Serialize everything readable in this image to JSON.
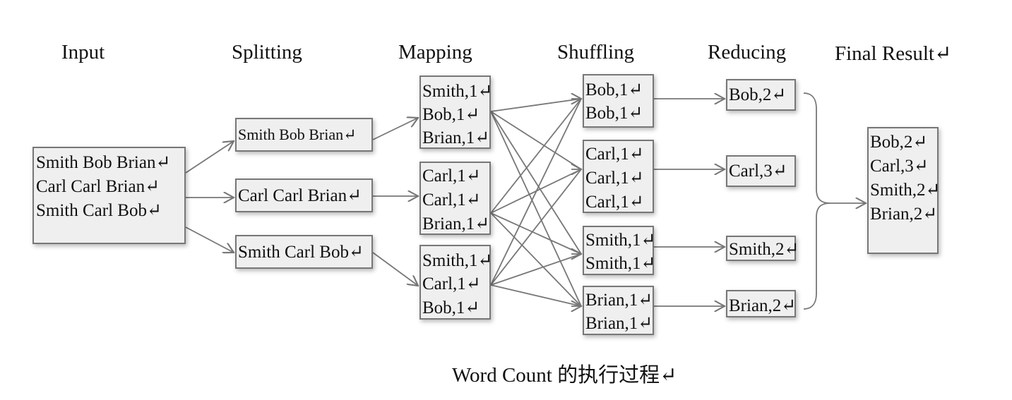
{
  "headers": {
    "input": "Input",
    "splitting": "Splitting",
    "mapping": "Mapping",
    "shuffling": "Shuffling",
    "reducing": "Reducing",
    "final": "Final Result↵"
  },
  "input": {
    "lines": [
      "Smith Bob Brian↵",
      "Carl Carl Brian↵",
      "Smith Carl Bob↵"
    ]
  },
  "splits": [
    {
      "lines": [
        "Smith Bob Brian↵"
      ]
    },
    {
      "lines": [
        "Carl Carl Brian↵"
      ]
    },
    {
      "lines": [
        "Smith Carl Bob↵"
      ]
    }
  ],
  "maps": [
    {
      "lines": [
        "Smith,1↵",
        "Bob,1↵",
        "Brian,1↵"
      ]
    },
    {
      "lines": [
        "Carl,1↵",
        "Carl,1↵",
        "Brian,1↵"
      ]
    },
    {
      "lines": [
        "Smith,1↵",
        "Carl,1↵",
        "Bob,1↵"
      ]
    }
  ],
  "shuffles": [
    {
      "lines": [
        "Bob,1↵",
        "Bob,1↵"
      ]
    },
    {
      "lines": [
        "Carl,1↵",
        "Carl,1↵",
        "Carl,1↵"
      ]
    },
    {
      "lines": [
        "Smith,1↵",
        "Smith,1↵"
      ]
    },
    {
      "lines": [
        "Brian,1↵",
        "Brian,1↵"
      ]
    }
  ],
  "reduces": [
    {
      "lines": [
        "Bob,2↵"
      ]
    },
    {
      "lines": [
        "Carl,3↵"
      ]
    },
    {
      "lines": [
        "Smith,2↵"
      ]
    },
    {
      "lines": [
        "Brian,2↵"
      ]
    }
  ],
  "final": {
    "lines": [
      "Bob,2↵",
      "Carl,3↵",
      "Smith,2↵",
      "Brian,2↵"
    ]
  },
  "caption": "Word Count 的执行过程↵",
  "colors": {
    "box_fill": "#efefef",
    "box_border": "#777777",
    "arrow": "#777777",
    "text": "#111111"
  }
}
